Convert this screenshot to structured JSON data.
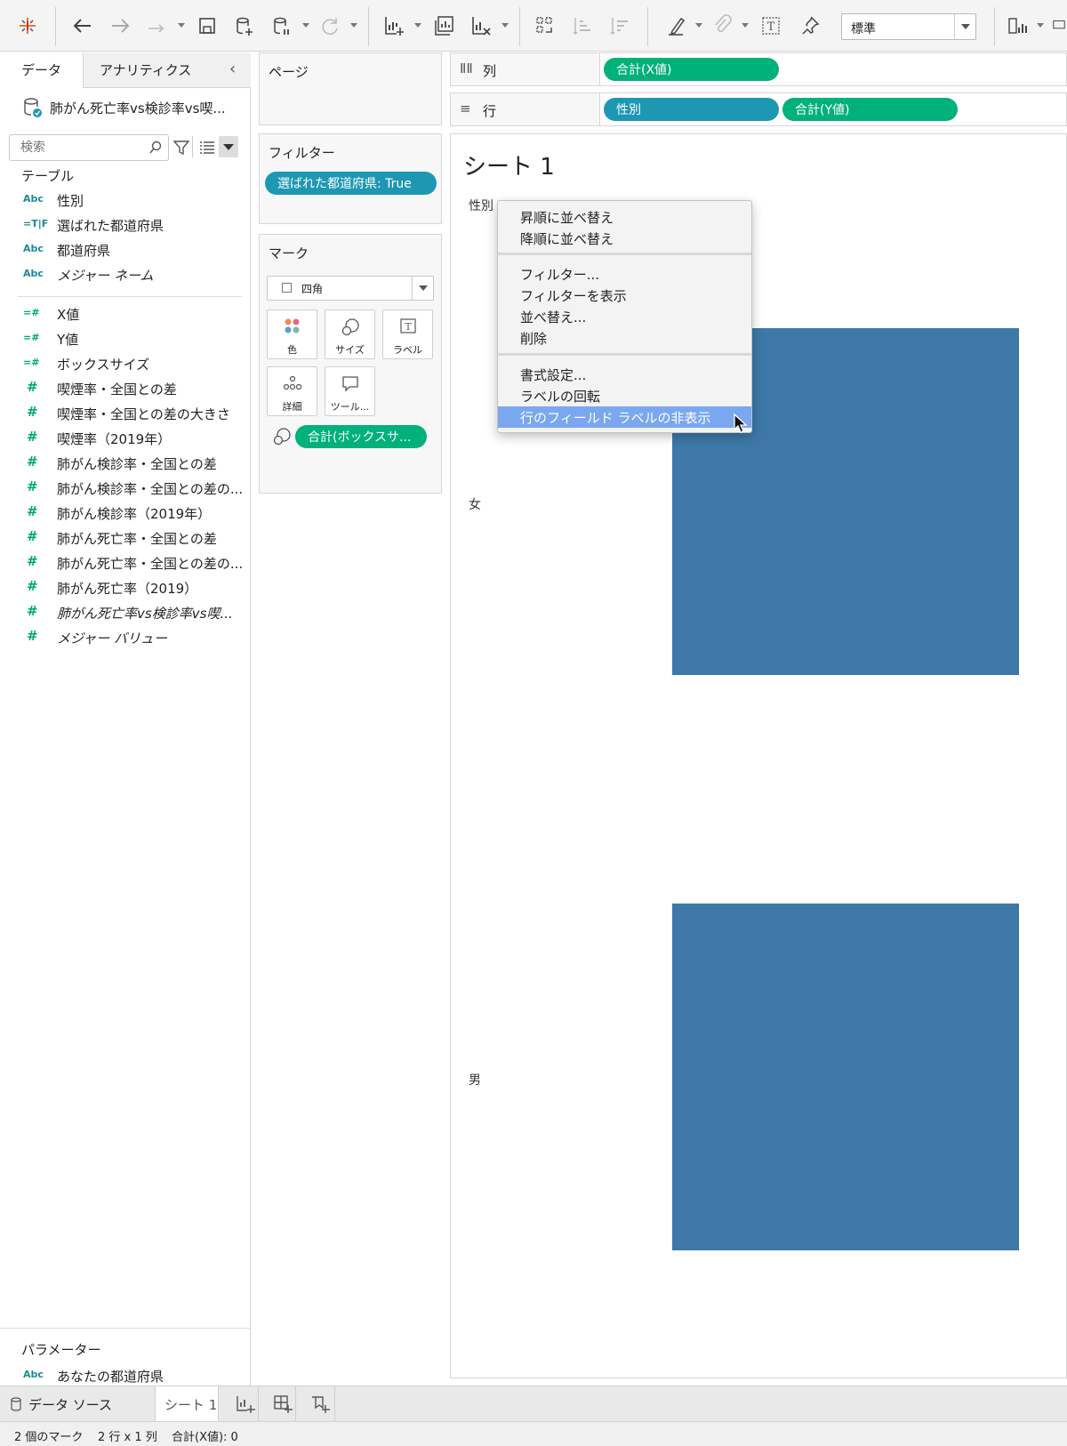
{
  "toolbar": {
    "view_mode": "標準"
  },
  "data_pane": {
    "tab_data": "データ",
    "tab_analytics": "アナリティクス",
    "datasource": "肺がん死亡率vs検診率vs喫...",
    "search_placeholder": "検索",
    "tables_heading": "テーブル",
    "dimensions": [
      {
        "type": "Abc",
        "name": "性別"
      },
      {
        "type": "=T|F",
        "name": "選ばれた都道府県"
      },
      {
        "type": "Abc",
        "name": "都道府県"
      },
      {
        "type": "Abc",
        "name": "メジャー ネーム"
      }
    ],
    "measures": [
      {
        "type": "=#",
        "name": "X値"
      },
      {
        "type": "=#",
        "name": "Y値"
      },
      {
        "type": "=#",
        "name": "ボックスサイズ"
      },
      {
        "type": "#",
        "name": "喫煙率・全国との差"
      },
      {
        "type": "#",
        "name": "喫煙率・全国との差の大きさ"
      },
      {
        "type": "#",
        "name": "喫煙率（2019年）"
      },
      {
        "type": "#",
        "name": "肺がん検診率・全国との差"
      },
      {
        "type": "#",
        "name": "肺がん検診率・全国との差の..."
      },
      {
        "type": "#",
        "name": "肺がん検診率（2019年）"
      },
      {
        "type": "#",
        "name": "肺がん死亡率・全国との差"
      },
      {
        "type": "#",
        "name": "肺がん死亡率・全国との差の..."
      },
      {
        "type": "#",
        "name": "肺がん死亡率（2019）"
      },
      {
        "type": "#",
        "name": "肺がん死亡率vs検診率vs喫..."
      },
      {
        "type": "#",
        "name": "メジャー バリュー"
      }
    ],
    "parameters_heading": "パラメーター",
    "parameters": [
      {
        "type": "Abc",
        "name": "あなたの都道府県"
      }
    ]
  },
  "pages_card": {
    "title": "ページ"
  },
  "filters_card": {
    "title": "フィルター",
    "filter_pill": "選ばれた都道府県: True"
  },
  "marks_card": {
    "title": "マーク",
    "mark_type": "四角",
    "buttons": {
      "color": "色",
      "size": "サイズ",
      "label": "ラベル",
      "detail": "詳細",
      "tooltip": "ツール..."
    },
    "size_pill": "合計(ボックスサ..."
  },
  "shelves": {
    "columns_label": "列",
    "columns_pills": [
      "合計(X値)"
    ],
    "rows_label": "行",
    "rows_pills": [
      "性別",
      "合計(Y値)"
    ]
  },
  "view": {
    "sheet_title": "シート 1",
    "row_header": "性別",
    "row_values": [
      "女",
      "男"
    ],
    "mark_color": "#3d78a8"
  },
  "context_menu": {
    "items": [
      "昇順に並べ替え",
      "降順に並べ替え",
      "フィルター...",
      "フィルターを表示",
      "並べ替え...",
      "削除",
      "書式設定...",
      "ラベルの回転",
      "行のフィールド ラベルの非表示"
    ],
    "highlighted": "行のフィールド ラベルの非表示"
  },
  "bottom_tabs": {
    "datasource": "データ ソース",
    "sheet": "シート 1"
  },
  "status": {
    "marks": "2 個のマーク",
    "dims": "2 行 x 1 列",
    "sum": "合計(X値): 0"
  }
}
